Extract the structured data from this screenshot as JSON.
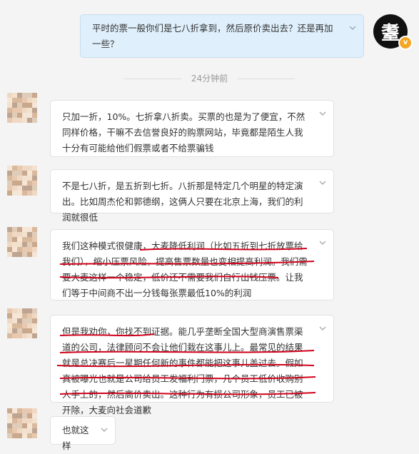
{
  "chat": {
    "outgoing_message": "平时的票一般你们是七八折拿到，然后原价卖出去？还是再加一些？",
    "user_avatar_char": "耋",
    "vip_badge": "v",
    "timestamp": "24分钟前",
    "incoming_messages": [
      "只加一折，10%。七折拿八折卖。买票的也是为了便宜，不然同样价格，干嘛不去信誉良好的购票网站，毕竟都是陌生人我十分有可能给他们假票或者不给票骗钱",
      "不是七八折，是五折到七折。八折那是特定几个明星的特定演出。比如周杰伦和郭德纲，这俩人只要在北京上海，我们的利润就很低",
      "我们这种模式很健康，大麦降低利润（比如五折到七折放票给我们），缩小压票风险，提高售票数量也变相提高利润。我们需要大麦这样一个稳定，低价还不需要我们自行出钱压票。让我们等于中间商不出一分钱每张票最低10%的利润",
      "但是我劝你，你找不到证据。能几乎垄断全国大型商演售票渠道的公司，法律顾问不会让他们栽在这事儿上。最常见的结果就是总决赛后一星期任何新的事件都能把这事儿盖过去。假如真被曝光也就是公司给员工发福利门票，几个员工低价收购别人手上的，然后高价卖出。这种行为有损公司形象，员工已被开除，大麦向社会道歉",
      "也就这样"
    ]
  },
  "colors": {
    "outgoing_bg": "#dff0fc",
    "incoming_bg": "#ffffff",
    "underline": "#d0021b",
    "badge": "#f5a623"
  }
}
